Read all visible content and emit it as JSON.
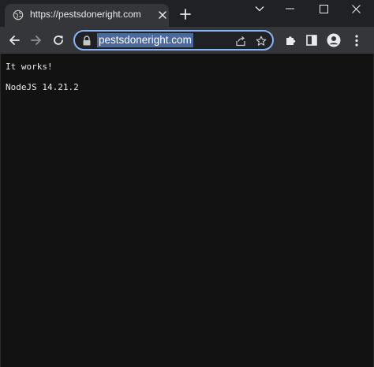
{
  "tab": {
    "title": "https://pestsdoneright.com",
    "favicon": "globe-icon",
    "close_icon": "close-icon"
  },
  "new_tab_icon": "plus-icon",
  "window_controls": [
    "chevron-down-icon",
    "minimize-icon",
    "maximize-icon",
    "close-icon"
  ],
  "toolbar": {
    "back_icon": "arrow-left-icon",
    "forward_icon": "arrow-right-icon",
    "reload_icon": "reload-icon",
    "address": "pestsdoneright.com",
    "lock_icon": "lock-icon",
    "share_icon": "share-icon",
    "bookmark_icon": "star-icon",
    "extensions_icon": "puzzle-icon",
    "sidepanel_icon": "side-panel-icon",
    "profile_icon": "profile-icon",
    "menu_icon": "kebab-menu-icon"
  },
  "page": {
    "line1": "It works!",
    "line2": "NodeJS 14.21.2"
  },
  "colors": {
    "frame": "#202124",
    "toolbar": "#35363a",
    "focus_ring": "#8ab4f8",
    "selection": "#4b6a9b",
    "page_bg": "#121212"
  }
}
